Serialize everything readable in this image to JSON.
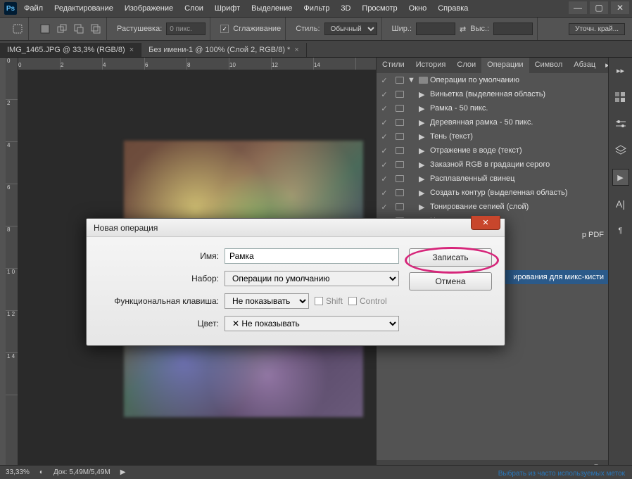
{
  "menu": [
    "Файл",
    "Редактирование",
    "Изображение",
    "Слои",
    "Шрифт",
    "Выделение",
    "Фильтр",
    "3D",
    "Просмотр",
    "Окно",
    "Справка"
  ],
  "options": {
    "feather_label": "Растушевка:",
    "feather_value": "0 пикс.",
    "antialias_label": "Сглаживание",
    "style_label": "Стиль:",
    "style_value": "Обычный",
    "width_label": "Шир.:",
    "height_label": "Выс.:",
    "refine_edge": "Уточн. край..."
  },
  "tabs": [
    {
      "label": "IMG_1465.JPG @ 33,3% (RGB/8)",
      "active": true
    },
    {
      "label": "Без имени-1 @ 100% (Слой 2, RGB/8) *",
      "active": false
    }
  ],
  "ruler_v": [
    "0",
    "2",
    "4",
    "6",
    "8",
    "1 0",
    "1 2",
    "1 4"
  ],
  "ruler_h": [
    "0",
    "2",
    "4",
    "6",
    "8",
    "10",
    "12",
    "14"
  ],
  "panel_tabs": [
    "Стили",
    "История",
    "Слои",
    "Операции",
    "Символ",
    "Абзац"
  ],
  "panel_active": 3,
  "actions_root": "Операции по умолчанию",
  "actions": [
    "Виньетка (выделенная область)",
    "Рамка - 50 пикс.",
    "Деревянная рамка - 50 пикс.",
    "Тень (текст)",
    "Отражение в воде (текст)",
    "Заказной RGB в градации серого",
    "Расплавленный свинец",
    "Создать контур (выделенная область)",
    "Тонирование сепией (слой)",
    "Цвета квадранта"
  ],
  "action_cut1": "p PDF",
  "action_cut2": "ирования для микс-кисти",
  "dialog": {
    "title": "Новая операция",
    "name_label": "Имя:",
    "name_value": "Рамка",
    "set_label": "Набор:",
    "set_value": "Операции по умолчанию",
    "fkey_label": "Функциональная клавиша:",
    "fkey_value": "Не показывать",
    "shift_label": "Shift",
    "control_label": "Control",
    "color_label": "Цвет:",
    "color_value": "Не показывать",
    "record": "Записать",
    "cancel": "Отмена"
  },
  "status": {
    "zoom": "33,33%",
    "doc": "Док: 5,49M/5,49M"
  },
  "footer_link": "Выбрать из часто используемых меток"
}
